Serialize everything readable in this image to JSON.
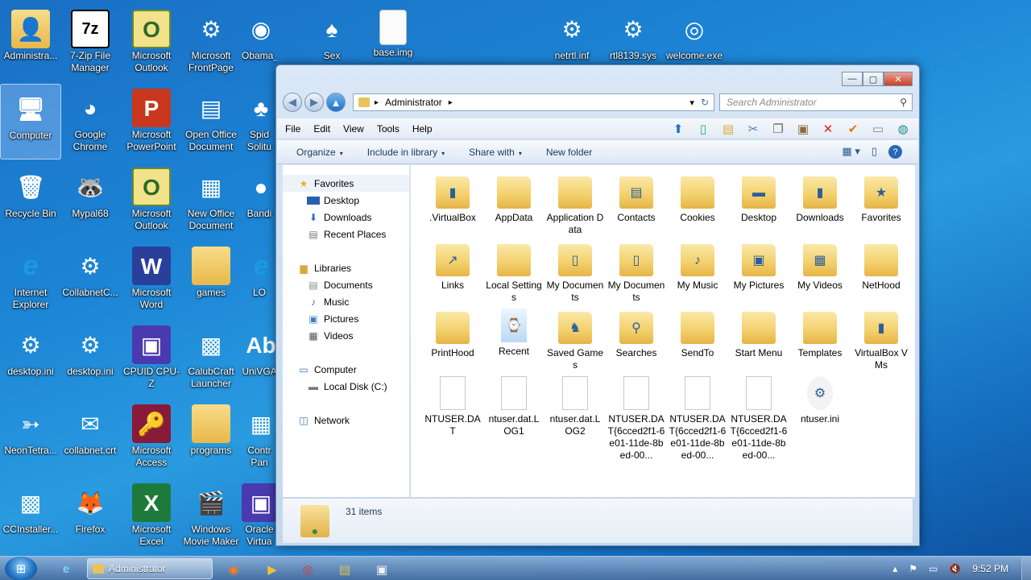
{
  "desktop": {
    "icons": [
      {
        "label": "Administra...",
        "glyph": "👤"
      },
      {
        "label": "7-Zip File Manager",
        "glyph": "7z"
      },
      {
        "label": "Microsoft Outlook",
        "glyph": "O"
      },
      {
        "label": "Microsoft FrontPage",
        "glyph": "⚙"
      },
      {
        "label": "Obama_Bro...",
        "glyph": "◉"
      },
      {
        "label": "Sex",
        "glyph": "♠"
      },
      {
        "label": "base.img",
        "glyph": ""
      },
      {
        "label": "netrtl.inf",
        "glyph": "⚙"
      },
      {
        "label": "rtl8139.sys",
        "glyph": "⚙"
      },
      {
        "label": "welcome.exe",
        "glyph": "◎"
      },
      {
        "label": "Computer",
        "glyph": "🖥"
      },
      {
        "label": "Google Chrome",
        "glyph": "◕"
      },
      {
        "label": "Microsoft PowerPoint",
        "glyph": "P"
      },
      {
        "label": "Open Office Document",
        "glyph": "▤"
      },
      {
        "label": "Spid Solitu",
        "glyph": "♣"
      },
      {
        "label": "Recycle Bin",
        "glyph": "🗑"
      },
      {
        "label": "Mypal68",
        "glyph": "🦝"
      },
      {
        "label": "Microsoft Outlook",
        "glyph": "O"
      },
      {
        "label": "New Office Document",
        "glyph": "▦"
      },
      {
        "label": "Bandi",
        "glyph": "●"
      },
      {
        "label": "Internet Explorer",
        "glyph": "e"
      },
      {
        "label": "CollabnetC...",
        "glyph": "⚙"
      },
      {
        "label": "Microsoft Word",
        "glyph": "W"
      },
      {
        "label": "games",
        "glyph": ""
      },
      {
        "label": "LO",
        "glyph": "e"
      },
      {
        "label": "desktop.ini",
        "glyph": "⚙"
      },
      {
        "label": "desktop.ini",
        "glyph": "⚙"
      },
      {
        "label": "CPUID CPU-Z",
        "glyph": "▣"
      },
      {
        "label": "CalubCraft Launcher",
        "glyph": "▩"
      },
      {
        "label": "UniVGA",
        "glyph": "Ab"
      },
      {
        "label": "NeonTetra...",
        "glyph": "➳"
      },
      {
        "label": "collabnet.crt",
        "glyph": "✉"
      },
      {
        "label": "Microsoft Access",
        "glyph": "🔑"
      },
      {
        "label": "programs",
        "glyph": ""
      },
      {
        "label": "Contr Pan",
        "glyph": "▦"
      },
      {
        "label": "CCInstaller...",
        "glyph": "▩"
      },
      {
        "label": "Firefox",
        "glyph": "🦊"
      },
      {
        "label": "Microsoft Excel",
        "glyph": "X"
      },
      {
        "label": "Windows Movie Maker",
        "glyph": "🎬"
      },
      {
        "label": "Oracle Virtua",
        "glyph": "▣"
      }
    ]
  },
  "window": {
    "controls": {
      "minimize": "—",
      "maximize": "▢",
      "close": "✕"
    },
    "address": {
      "crumb_sep": "▸",
      "path": "Administrator",
      "dropdown": "▾",
      "refresh": "↻"
    },
    "search": {
      "placeholder": "Search Administrator",
      "icon": "⚲"
    },
    "menu": [
      "File",
      "Edit",
      "View",
      "Tools",
      "Help"
    ],
    "command_bar": [
      "Organize",
      "Include in library",
      "Share with",
      "New folder"
    ],
    "command_caret": "▾",
    "nav": {
      "favorites": {
        "title": "Favorites",
        "items": [
          "Desktop",
          "Downloads",
          "Recent Places"
        ]
      },
      "libraries": {
        "title": "Libraries",
        "items": [
          "Documents",
          "Music",
          "Pictures",
          "Videos"
        ]
      },
      "computer": {
        "title": "Computer",
        "items": [
          "Local Disk (C:)"
        ]
      },
      "network": {
        "title": "Network"
      }
    },
    "files": [
      {
        "name": ".VirtualBox",
        "kind": "folder",
        "badge": "▮"
      },
      {
        "name": "AppData",
        "kind": "folder",
        "badge": ""
      },
      {
        "name": "Application Data",
        "kind": "folder",
        "badge": ""
      },
      {
        "name": "Contacts",
        "kind": "folder",
        "badge": "▤"
      },
      {
        "name": "Cookies",
        "kind": "folder",
        "badge": ""
      },
      {
        "name": "Desktop",
        "kind": "folder",
        "badge": "▬"
      },
      {
        "name": "Downloads",
        "kind": "folder",
        "badge": "▮"
      },
      {
        "name": "Favorites",
        "kind": "folder",
        "badge": "★"
      },
      {
        "name": "Links",
        "kind": "folder",
        "badge": "↗"
      },
      {
        "name": "Local Settings",
        "kind": "folder",
        "badge": ""
      },
      {
        "name": "My Documents",
        "kind": "folder",
        "badge": "▯"
      },
      {
        "name": "My Documents",
        "kind": "folder",
        "badge": "▯"
      },
      {
        "name": "My Music",
        "kind": "folder",
        "badge": "♪"
      },
      {
        "name": "My Pictures",
        "kind": "folder",
        "badge": "▣"
      },
      {
        "name": "My Videos",
        "kind": "folder",
        "badge": "▦"
      },
      {
        "name": "NetHood",
        "kind": "folder",
        "badge": ""
      },
      {
        "name": "PrintHood",
        "kind": "folder",
        "badge": ""
      },
      {
        "name": "Recent",
        "kind": "special",
        "badge": "⌚"
      },
      {
        "name": "Saved Games",
        "kind": "folder",
        "badge": "♞"
      },
      {
        "name": "Searches",
        "kind": "folder",
        "badge": "⚲"
      },
      {
        "name": "SendTo",
        "kind": "folder",
        "badge": ""
      },
      {
        "name": "Start Menu",
        "kind": "folder",
        "badge": ""
      },
      {
        "name": "Templates",
        "kind": "folder",
        "badge": ""
      },
      {
        "name": "VirtualBox VMs",
        "kind": "folder",
        "badge": "▮"
      },
      {
        "name": "NTUSER.DAT",
        "kind": "file",
        "badge": ""
      },
      {
        "name": "ntuser.dat.LOG1",
        "kind": "file",
        "badge": ""
      },
      {
        "name": "ntuser.dat.LOG2",
        "kind": "file",
        "badge": ""
      },
      {
        "name": "NTUSER.DAT{6cced2f1-6e01-11de-8bed-00...",
        "kind": "file",
        "badge": ""
      },
      {
        "name": "NTUSER.DAT{6cced2f1-6e01-11de-8bed-00...",
        "kind": "file",
        "badge": ""
      },
      {
        "name": "NTUSER.DAT{6cced2f1-6e01-11de-8bed-00...",
        "kind": "file",
        "badge": ""
      },
      {
        "name": "ntuser.ini",
        "kind": "ini",
        "badge": "⚙"
      }
    ],
    "status": {
      "count": "31 items"
    }
  },
  "taskbar": {
    "active_label": "Administrator",
    "clock": "9:52 PM",
    "tray_expand": "▴"
  }
}
